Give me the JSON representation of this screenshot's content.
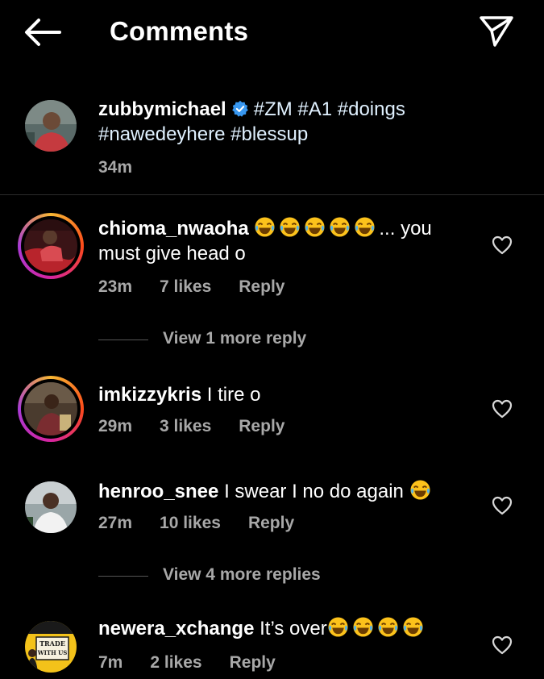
{
  "header": {
    "title": "Comments"
  },
  "caption": {
    "username": "zubbymichael",
    "text_line1": "#ZM #A1 #doings",
    "text_line2": "#nawedeyhere #blessup",
    "time": "34m"
  },
  "comments": [
    {
      "username": "chioma_nwaoha",
      "text_after_emoji": "... you",
      "text_line2": "must give head o",
      "time": "23m",
      "likes": "7 likes",
      "reply": "Reply",
      "view_more": "View 1 more reply"
    },
    {
      "username": "imkizzykris",
      "text": "I tire o",
      "time": "29m",
      "likes": "3 likes",
      "reply": "Reply"
    },
    {
      "username": "henroo_snee",
      "text": "I swear I no do again",
      "time": "27m",
      "likes": "10 likes",
      "reply": "Reply",
      "view_more": "View 4 more replies"
    },
    {
      "username": "newera_xchange",
      "text": "It’s over",
      "time": "7m",
      "likes": "2 likes",
      "reply": "Reply"
    }
  ],
  "avatar_badge_text": "TRADE WITH US",
  "icons": [
    "back-arrow-icon",
    "send-icon",
    "verified-icon",
    "heart-icon",
    "laughing-emoji-icon"
  ]
}
